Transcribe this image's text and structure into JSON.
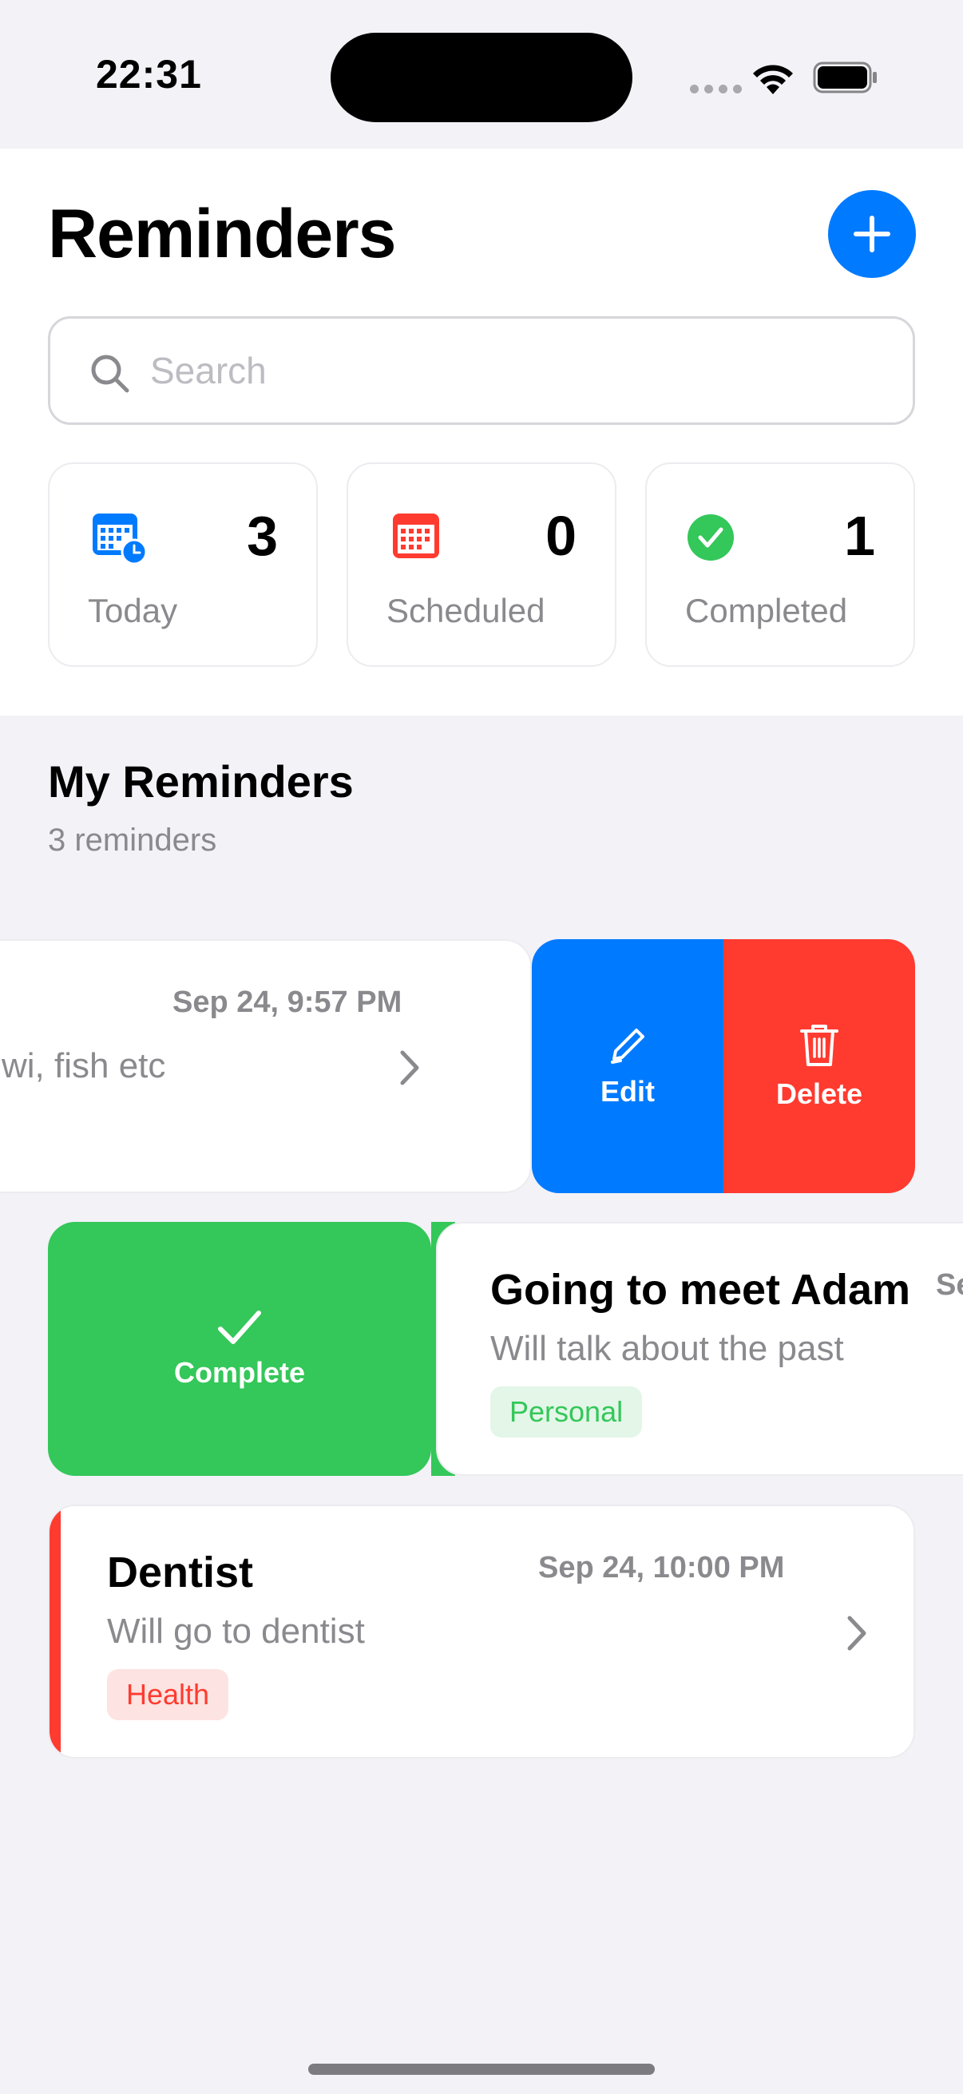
{
  "status_bar": {
    "time": "22:31"
  },
  "header": {
    "title": "Reminders",
    "add_button_icon": "plus-icon",
    "search_placeholder": "Search"
  },
  "stats": [
    {
      "label": "Today",
      "count": "3",
      "icon": "calendar-clock-icon",
      "color": "#007aff"
    },
    {
      "label": "Scheduled",
      "count": "0",
      "icon": "calendar-icon",
      "color": "#ff3b30"
    },
    {
      "label": "Completed",
      "count": "1",
      "icon": "checkmark-circle-icon",
      "color": "#34c759"
    }
  ],
  "section": {
    "title": "My Reminders",
    "subtitle": "3 reminders"
  },
  "reminders": [
    {
      "date": "Sep 24, 9:57 PM",
      "description": "wi, fish etc"
    },
    {
      "title": "Going to meet Adam",
      "date": "Se",
      "description": "Will talk about the past",
      "tag": "Personal",
      "tag_color": "#34c759"
    },
    {
      "title": "Dentist",
      "date": "Sep 24, 10:00 PM",
      "description": "Will go to dentist",
      "tag": "Health",
      "tag_color": "#ff3b30"
    }
  ],
  "actions": {
    "edit": "Edit",
    "delete": "Delete",
    "complete": "Complete"
  },
  "colors": {
    "accent": "#007aff",
    "danger": "#ff3b30",
    "success": "#34c759"
  }
}
